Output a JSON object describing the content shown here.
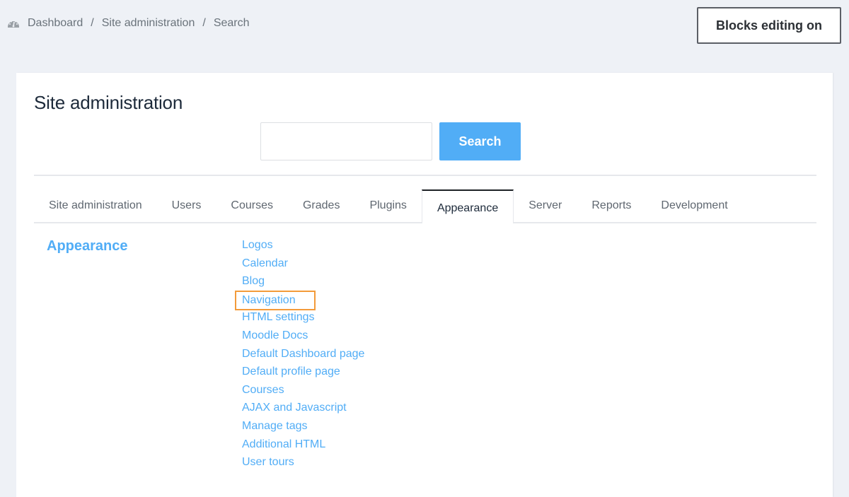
{
  "breadcrumb": {
    "icon": "dashboard-gauge-icon",
    "items": [
      "Dashboard",
      "Site administration",
      "Search"
    ],
    "separator": "/"
  },
  "header": {
    "blocks_editing_label": "Blocks editing on"
  },
  "main": {
    "title": "Site administration",
    "search": {
      "value": "",
      "placeholder": "",
      "button_label": "Search"
    },
    "tabs": [
      {
        "label": "Site administration",
        "active": false
      },
      {
        "label": "Users",
        "active": false
      },
      {
        "label": "Courses",
        "active": false
      },
      {
        "label": "Grades",
        "active": false
      },
      {
        "label": "Plugins",
        "active": false
      },
      {
        "label": "Appearance",
        "active": true
      },
      {
        "label": "Server",
        "active": false
      },
      {
        "label": "Reports",
        "active": false
      },
      {
        "label": "Development",
        "active": false
      }
    ],
    "section": {
      "heading": "Appearance",
      "links": [
        {
          "label": "Logos"
        },
        {
          "label": "Calendar"
        },
        {
          "label": "Blog"
        },
        {
          "label": "Navigation",
          "highlighted": true
        },
        {
          "label": "HTML settings"
        },
        {
          "label": "Moodle Docs"
        },
        {
          "label": "Default Dashboard page"
        },
        {
          "label": "Default profile page"
        },
        {
          "label": "Courses"
        },
        {
          "label": "AJAX and Javascript"
        },
        {
          "label": "Manage tags"
        },
        {
          "label": "Additional HTML"
        },
        {
          "label": "User tours"
        }
      ]
    }
  },
  "colors": {
    "accent": "#51adf6",
    "highlight_outline": "#f39b3a",
    "background": "#eef1f6"
  }
}
